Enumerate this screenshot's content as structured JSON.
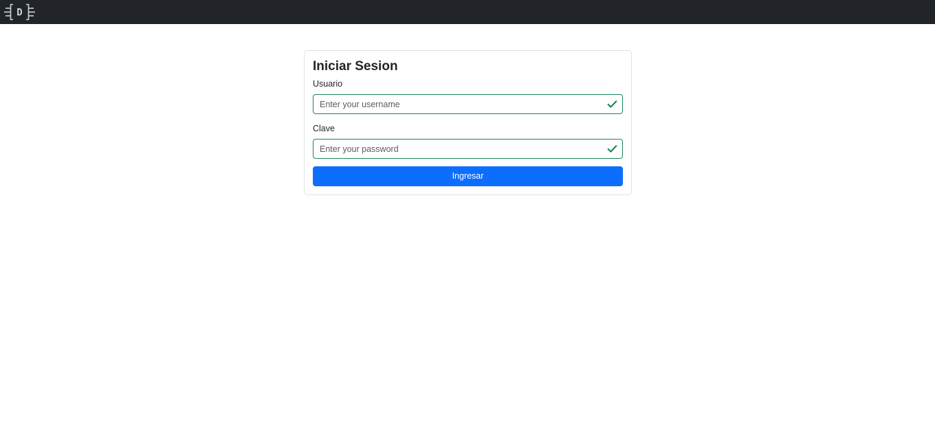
{
  "navbar": {
    "brand": {
      "icon": "brand-logo-bracket-d",
      "text": "D"
    }
  },
  "login": {
    "title": "Iniciar Sesion",
    "username": {
      "label": "Usuario",
      "value": "",
      "placeholder": "Enter your username",
      "status_icon": "check-icon"
    },
    "password": {
      "label": "Clave",
      "value": "",
      "placeholder": "Enter your password",
      "status_icon": "check-icon"
    },
    "submit_label": "Ingresar"
  },
  "colors": {
    "navbar_bg": "#212529",
    "primary": "#0d6efd",
    "valid": "#198754",
    "card_border": "#dee2e6"
  }
}
